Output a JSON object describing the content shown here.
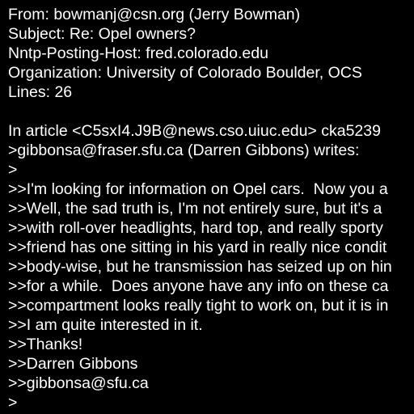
{
  "colors": {
    "background": "#000000",
    "text": "#ffffff"
  },
  "message": {
    "lines": [
      "From: bowmanj@csn.org (Jerry Bowman)",
      "Subject: Re: Opel owners?",
      "Nntp-Posting-Host: fred.colorado.edu",
      "Organization: University of Colorado Boulder, OCS",
      "Lines: 26",
      "",
      "In article <C5sxI4.J9B@news.cso.uiuc.edu> cka5239",
      ">gibbonsa@fraser.sfu.ca (Darren Gibbons) writes:",
      ">",
      ">>I'm looking for information on Opel cars.  Now you a",
      ">>Well, the sad truth is, I'm not entirely sure, but it's a",
      ">>with roll-over headlights, hard top, and really sporty",
      ">>friend has one sitting in his yard in really nice condit",
      ">>body-wise, but he transmission has seized up on hin",
      ">>for a while.  Does anyone have any info on these ca",
      ">>compartment looks really tight to work on, but it is in",
      ">>I am quite interested in it.",
      ">>Thanks!",
      ">>Darren Gibbons",
      ">>gibbonsa@sfu.ca",
      ">"
    ]
  }
}
